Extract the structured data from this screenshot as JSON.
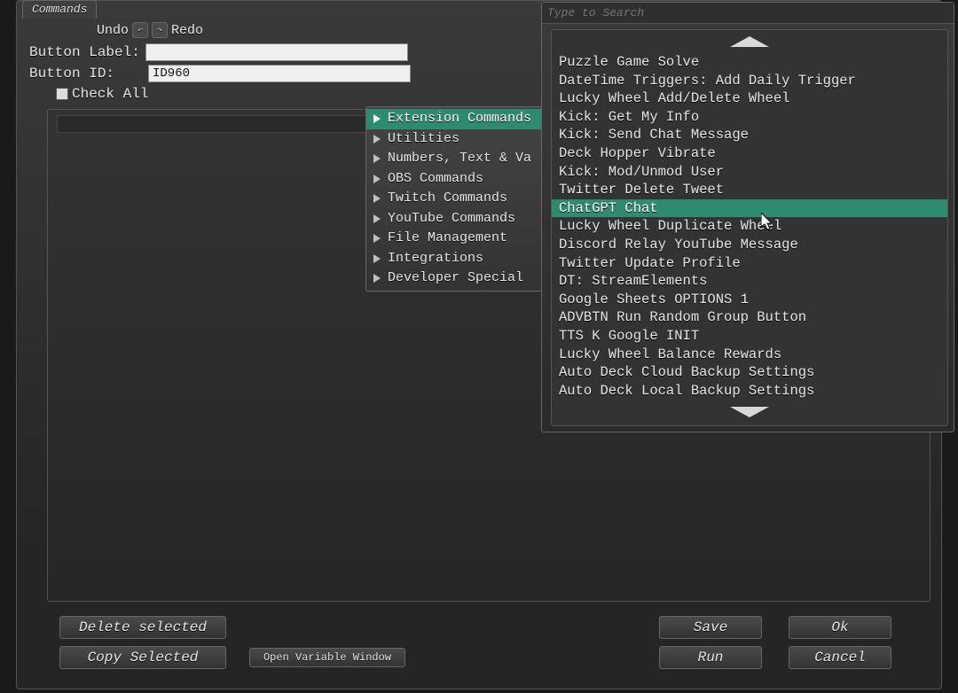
{
  "tab_title": "Commands",
  "toolbar": {
    "undo": "Undo",
    "redo": "Redo"
  },
  "form": {
    "button_label_text": "Button Label:",
    "button_label_value": "",
    "button_id_text": "Button ID:",
    "button_id_value": "ID960",
    "check_all": "Check All"
  },
  "context_menu": [
    "Extension Commands",
    "Utilities",
    "Numbers, Text & Va",
    "OBS Commands",
    "Twitch Commands",
    "YouTube Commands",
    "File Management",
    "Integrations",
    "Developer Special"
  ],
  "context_highlight_index": 0,
  "search": {
    "placeholder": "Type to Search",
    "items": [
      "Puzzle Game Solve",
      "DateTime Triggers: Add Daily Trigger",
      "Lucky Wheel Add/Delete Wheel",
      "Kick: Get My Info",
      "Kick: Send Chat Message",
      "Deck Hopper Vibrate",
      "Kick: Mod/Unmod User",
      "Twitter Delete Tweet",
      "ChatGPT Chat",
      "Lucky Wheel Duplicate Wheel",
      "Discord Relay YouTube Message",
      "Twitter Update Profile",
      "DT: StreamElements",
      "Google Sheets OPTIONS 1",
      "ADVBTN Run Random Group Button",
      "TTS K Google INIT",
      "Lucky Wheel Balance Rewards",
      "Auto Deck Cloud Backup Settings",
      "Auto Deck Local Backup Settings"
    ],
    "selected_index": 8
  },
  "buttons": {
    "delete": "Delete selected",
    "copy": "Copy Selected",
    "variable": "Open Variable Window",
    "save": "Save",
    "ok": "Ok",
    "run": "Run",
    "cancel": "Cancel"
  }
}
